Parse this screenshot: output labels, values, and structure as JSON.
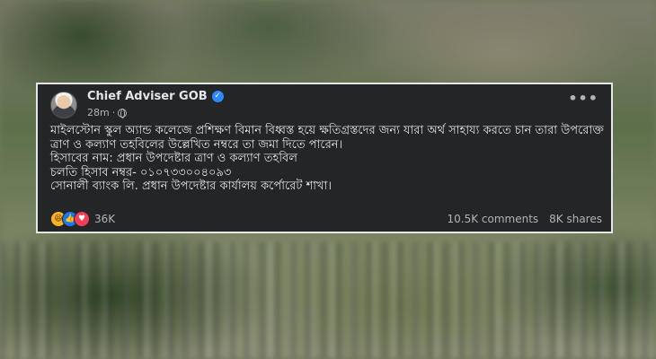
{
  "post": {
    "author": "Chief Adviser GOB",
    "time": "28m",
    "more_label": "•••",
    "text_lines": [
      "মাইলস্টোন স্কুল অ্যান্ড কলেজে প্রশিক্ষণ বিমান বিধ্বস্ত হয়ে ক্ষতিগ্রস্তদের জন্য যারা অর্থ সাহায্য করতে চান তারা উপরোক্ত ত্রাণ ও কল্যাণ তহবিলের উল্লেখিত নম্বরে তা জমা দিতে পারেন।",
      "হিসাবের নাম: প্রধান উপদেষ্টার ত্রাণ ও কল্যাণ তহবিল",
      "চলতি হিসাব নম্বর- ০১০৭৩৩০০৪০৯৩",
      "সোনালী ব্যাংক লি. প্রধান উপদেষ্টার কার্যালয় কর্পোরেট শাখা।"
    ],
    "reaction_count": "36K",
    "comments": "10.5K comments",
    "shares": "8K shares",
    "reaction_icons": [
      "haha-icon",
      "like-icon",
      "love-icon"
    ],
    "colors": {
      "card_bg": "#242526",
      "verified": "#2d88ff",
      "like": "#1877f2",
      "love": "#f33e58",
      "haha": "#f7b125"
    }
  }
}
